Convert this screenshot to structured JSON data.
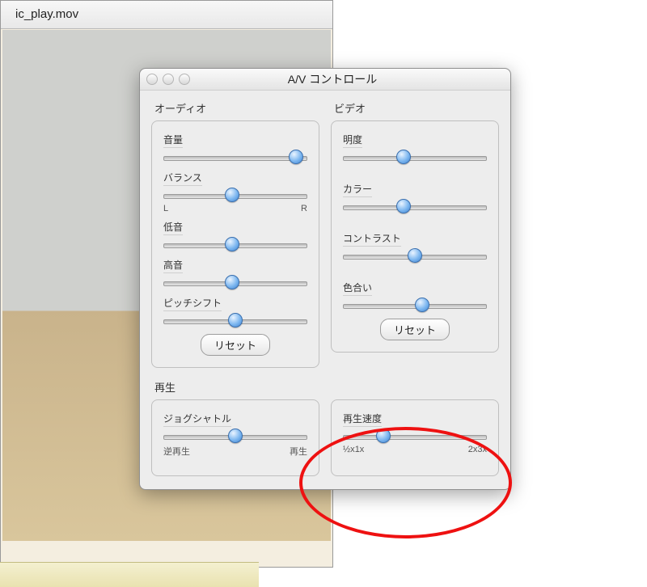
{
  "bg": {
    "title": "ic_play.mov"
  },
  "panel": {
    "title": "A/V コントロール",
    "audio": {
      "label": "オーディオ",
      "volume": {
        "label": "音量",
        "pos": 92
      },
      "balance": {
        "label": "バランス",
        "pos": 48,
        "left": "L",
        "right": "R"
      },
      "bass": {
        "label": "低音",
        "pos": 48
      },
      "treble": {
        "label": "高音",
        "pos": 48
      },
      "pitch": {
        "label": "ピッチシフト",
        "pos": 50
      },
      "reset": "リセット"
    },
    "video": {
      "label": "ビデオ",
      "brightness": {
        "label": "明度",
        "pos": 42
      },
      "color": {
        "label": "カラー",
        "pos": 42
      },
      "contrast": {
        "label": "コントラスト",
        "pos": 50
      },
      "tint": {
        "label": "色合い",
        "pos": 55
      },
      "reset": "リセット"
    },
    "playback": {
      "label": "再生",
      "jog": {
        "label": "ジョグシャトル",
        "pos": 50,
        "left": "逆再生",
        "right": "再生"
      },
      "speed": {
        "label": "再生速度",
        "pos": 28,
        "ticks": [
          "½x",
          "1x",
          "2x",
          "3x"
        ]
      }
    }
  }
}
